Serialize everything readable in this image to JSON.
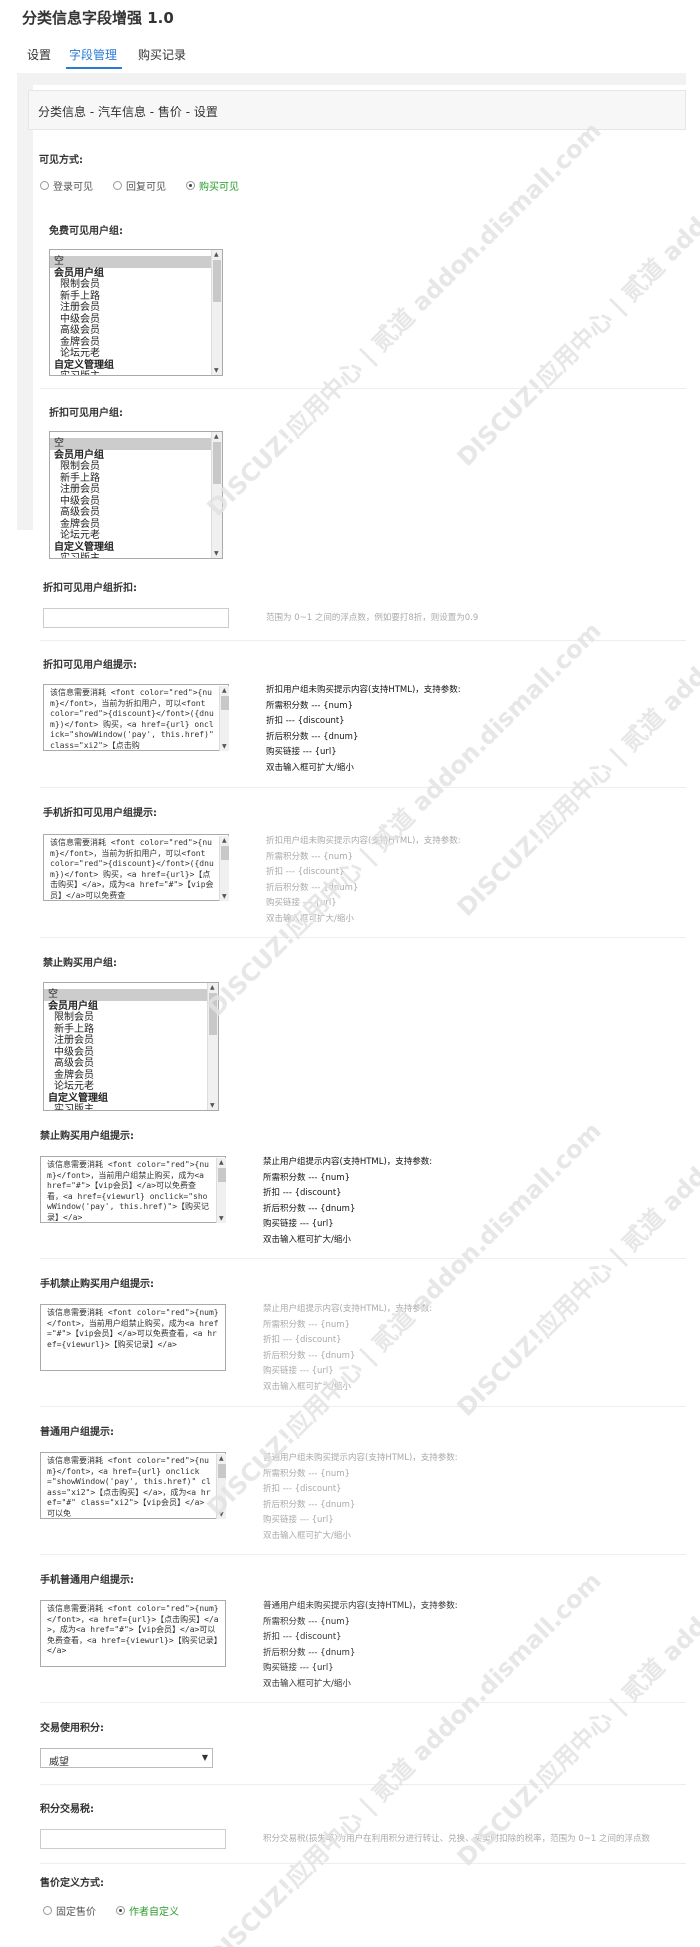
{
  "title": "分类信息字段增强 1.0",
  "tabs": [
    {
      "label": "设置"
    },
    {
      "label": "字段管理"
    },
    {
      "label": "购买记录"
    }
  ],
  "subheader": "分类信息 - 汽车信息 - 售价 - 设置",
  "visibility": {
    "label": "可见方式:",
    "options": [
      "登录可见",
      "回复可见",
      "购买可见"
    ],
    "selected": 2
  },
  "free_groups": {
    "label": "免费可见用户组:"
  },
  "discount_groups": {
    "label": "折扣可见用户组:"
  },
  "group_options": [
    "空",
    "会员用户组",
    "限制会员",
    "新手上路",
    "注册会员",
    "中级会员",
    "高级会员",
    "金牌会员",
    "论坛元老",
    "自定义管理组",
    "实习版主"
  ],
  "discount_rate": {
    "label": "折扣可见用户组折扣:",
    "value": "",
    "hint": "范围为 0~1 之间的浮点数，例如要打8折，则设置为0.9"
  },
  "discount_tip": {
    "label": "折扣可见用户组提示:",
    "value": "该信息需要消耗 <font color=\"red\">{num}</font>，当前为折扣用户，可以<font color=\"red\">{discount}</font>({dnum})</font> 购买，<a href={url} onclick=\"showWindow('pay', this.href)\" class=\"xi2\">【点击购",
    "hint": "折扣用户组未购买提示内容(支持HTML)，支持参数:\n所需积分数 --- {num}\n折扣 --- {discount}\n折后积分数 --- {dnum}\n购买链接 --- {url}\n双击输入框可扩大/缩小"
  },
  "mobile_discount_tip": {
    "label": "手机折扣可见用户组提示:",
    "value": "该信息需要消耗 <font color=\"red\">{num}</font>，当前为折扣用户，可以<font color=\"red\">{discount}</font>({dnum})</font> 购买，<a href={url}>【点击购买】</a>，成为<a href=\"#\">【vip会员】</a>可以免费查",
    "hint": "折扣用户组未购买提示内容(支持HTML)，支持参数:\n所需积分数 --- {num}\n折扣 --- {discount}\n折后积分数 --- {dnum}\n购买链接 --- {url}\n双击输入框可扩大/缩小"
  },
  "ban_groups": {
    "label": "禁止购买用户组:"
  },
  "ban_tip": {
    "label": "禁止购买用户组提示:",
    "value": "该信息需要消耗 <font color=\"red\">{num}</font>，当前用户组禁止购买，成为<a href=\"#\">【vip会员】</a>可以免费查看，<a href={viewurl} onclick=\"showWindow('pay', this.href)\">【购买记录】</a>",
    "hint": "禁止用户组提示内容(支持HTML)，支持参数:\n所需积分数 --- {num}\n折扣 --- {discount}\n折后积分数 --- {dnum}\n购买链接 --- {url}\n双击输入框可扩大/缩小"
  },
  "mobile_ban_tip": {
    "label": "手机禁止购买用户组提示:",
    "value": "该信息需要消耗 <font color=\"red\">{num}</font>，当前用户组禁止购买，成为<a href=\"#\">【vip会员】</a>可以免费查看，<a href={viewurl}>【购买记录】</a>",
    "hint": "禁止用户组提示内容(支持HTML)，支持参数:\n所需积分数 --- {num}\n折扣 --- {discount}\n折后积分数 --- {dnum}\n购买链接 --- {url}\n双击输入框可扩大/缩小"
  },
  "normal_tip": {
    "label": "普通用户组提示:",
    "value": "该信息需要消耗 <font color=\"red\">{num}</font>，<a href={url} onclick=\"showWindow('pay', this.href)\" class=\"xi2\">【点击购买】</a>，成为<a href=\"#\" class=\"xi2\">【vip会员】</a>可以免",
    "hint": "普通用户组未购买提示内容(支持HTML)，支持参数:\n所需积分数 --- {num}\n折扣 --- {discount}\n折后积分数 --- {dnum}\n购买链接 --- {url}\n双击输入框可扩大/缩小"
  },
  "mobile_normal_tip": {
    "label": "手机普通用户组提示:",
    "value": "该信息需要消耗 <font color=\"red\">{num}</font>，<a href={url}>【点击购买】</a>，成为<a href=\"#\">【vip会员】</a>可以免费查看，<a href={viewurl}>【购买记录】</a>",
    "hint": "普通用户组未购买提示内容(支持HTML)，支持参数:\n所需积分数 --- {num}\n折扣 --- {discount}\n折后积分数 --- {dnum}\n购买链接 --- {url}\n双击输入框可扩大/缩小"
  },
  "credit": {
    "label": "交易使用积分:",
    "value": "威望"
  },
  "tax": {
    "label": "积分交易税:",
    "value": "",
    "hint": "积分交易税(损失率)为用户在利用积分进行转让、兑换、买卖时扣除的税率，范围为 0~1 之间的浮点数"
  },
  "price_mode": {
    "label": "售价定义方式:",
    "options": [
      "固定售价",
      "作者自定义"
    ],
    "selected": 1
  },
  "watermark": "DISCUZ!应用中心 | 贰道 addon.dismall.com"
}
